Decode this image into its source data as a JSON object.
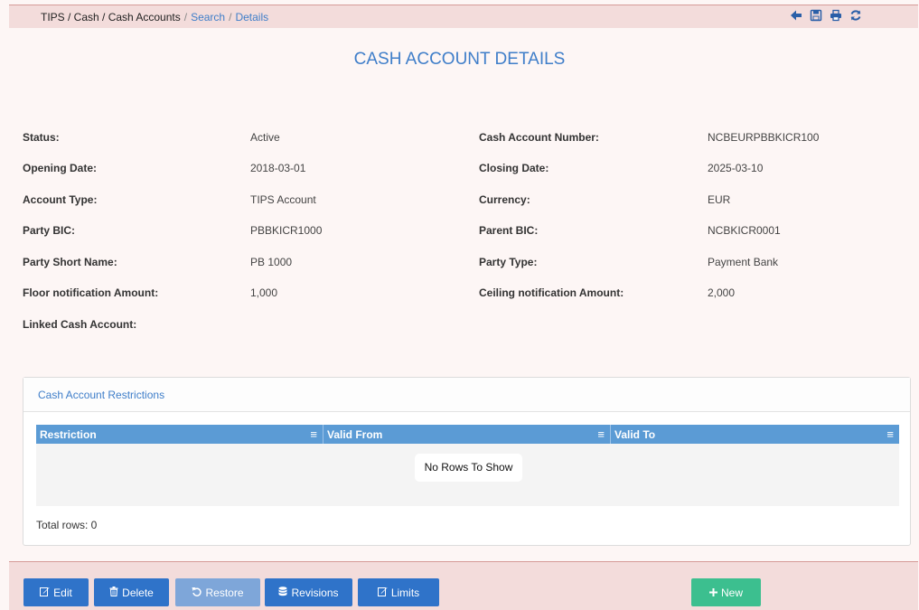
{
  "breadcrumb": {
    "path": "TIPS / Cash / Cash Accounts",
    "sep1": "/",
    "search": "Search",
    "sep2": "/",
    "details": "Details"
  },
  "toolbar_icons": [
    "back-arrow-icon",
    "save-icon",
    "print-icon",
    "refresh-icon"
  ],
  "title": "CASH ACCOUNT DETAILS",
  "fields": {
    "status": {
      "label": "Status:",
      "value": "Active"
    },
    "cash_account_number": {
      "label": "Cash Account Number:",
      "value": "NCBEURPBBKICR100"
    },
    "opening_date": {
      "label": "Opening Date:",
      "value": "2018-03-01"
    },
    "closing_date": {
      "label": "Closing Date:",
      "value": "2025-03-10"
    },
    "account_type": {
      "label": "Account Type:",
      "value": "TIPS Account"
    },
    "currency": {
      "label": "Currency:",
      "value": "EUR"
    },
    "party_bic": {
      "label": "Party BIC:",
      "value": "PBBKICR1000"
    },
    "parent_bic": {
      "label": "Parent BIC:",
      "value": "NCBKICR0001"
    },
    "party_short_name": {
      "label": "Party Short Name:",
      "value": "PB 1000"
    },
    "party_type": {
      "label": "Party Type:",
      "value": "Payment Bank"
    },
    "floor_amount": {
      "label": "Floor notification Amount:",
      "value": "1,000"
    },
    "ceiling_amount": {
      "label": "Ceiling notification Amount:",
      "value": "2,000"
    },
    "linked_cash_account": {
      "label": "Linked Cash Account:",
      "value": ""
    }
  },
  "restrictions": {
    "title": "Cash Account Restrictions",
    "columns": [
      "Restriction",
      "Valid From",
      "Valid To"
    ],
    "menu_glyph": "≡",
    "empty_text": "No Rows To Show",
    "total": "Total rows: 0"
  },
  "buttons": {
    "edit": "Edit",
    "delete": "Delete",
    "restore": "Restore",
    "revisions": "Revisions",
    "limits": "Limits",
    "new": "New"
  },
  "colors": {
    "accent": "#3f7ec9",
    "button_blue": "#2f73c9",
    "button_green": "#3cbf8f",
    "grid_header": "#5b9bd5",
    "bar_bg": "#f3dcdb"
  }
}
